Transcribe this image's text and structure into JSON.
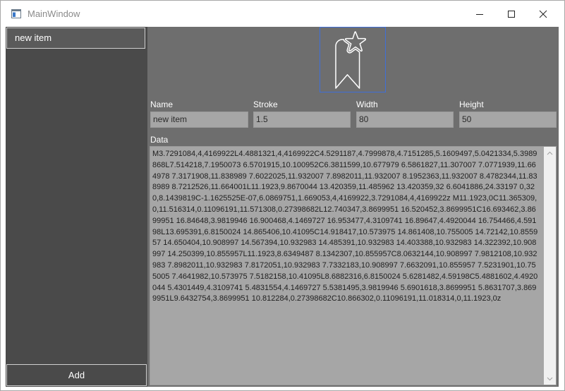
{
  "window": {
    "title": "MainWindow"
  },
  "sidebar": {
    "items": [
      {
        "label": "new item"
      }
    ],
    "add_label": "Add"
  },
  "preview": {
    "icon": "bookmark-star-icon",
    "border_color": "#3f6fd8"
  },
  "form": {
    "name": {
      "label": "Name",
      "value": "new item"
    },
    "stroke": {
      "label": "Stroke",
      "value": "1.5"
    },
    "width": {
      "label": "Width",
      "value": "80"
    },
    "height": {
      "label": "Height",
      "value": "50"
    }
  },
  "data": {
    "label": "Data",
    "value": "M3.7291084,4,4169922L4.4881321,4,4169922C4.5291187,4.7999878,4.7151285,5.1609497,5.0421334,5.3989868L7.514218,7.1950073 6.5701915,10.100952C6.3811599,10.677979 6.5861827,11.307007 7.0771939,11.664978 7.3171908,11.838989 7.6022025,11.932007 7.8982011,11.932007 8.1952363,11.932007 8.4782344,11.838989 8.7212526,11.664001L11.1923,9.8670044 13.420359,11.485962 13.420359,32 6.6041886,24.33197 0,32 0,8.1439819C-1.1625525E-07,6.0869751,1.669053,4,4169922,3.7291084,4,4169922z M11.1923,0C11.365309,0,11.516314,0.11096191,11.571308,0.27398682L12.740347,3.8699951 16.520452,3.8699951C16.693462,3.8699951 16.84648,3.9819946 16.900468,4.1469727 16.953477,4.3109741 16.89647,4.4920044 16.754466,4.59198L13.695391,6.8150024 14.865406,10.41095C14.918417,10.573975 14.861408,10.755005 14.72142,10.855957 14.650404,10.908997 14.567394,10.932983 14.485391,10.932983 14.403388,10.932983 14.322392,10.908997 14.250399,10.855957L11.1923,8.6349487 8.1342307,10.855957C8.0632144,10.908997 7.9812108,10.932983 7.8982011,10.932983 7.8172051,10.932983 7.7332183,10.908997 7.6632091,10.855957 7.5231901,10.755005 7.4641982,10.573975 7.5182158,10.41095L8.6882316,6.8150024 5.6281482,4.59198C5.4881602,4.4920044 5.4301449,4.3109741 5.4831554,4.1469727 5.5381495,3.9819946 5.6901618,3.8699951 5.8631707,3.8699951L9.6432754,3.8699951 10.812284,0.27398682C10.866302,0.11096191,11.018314,0,11.1923,0z"
  }
}
